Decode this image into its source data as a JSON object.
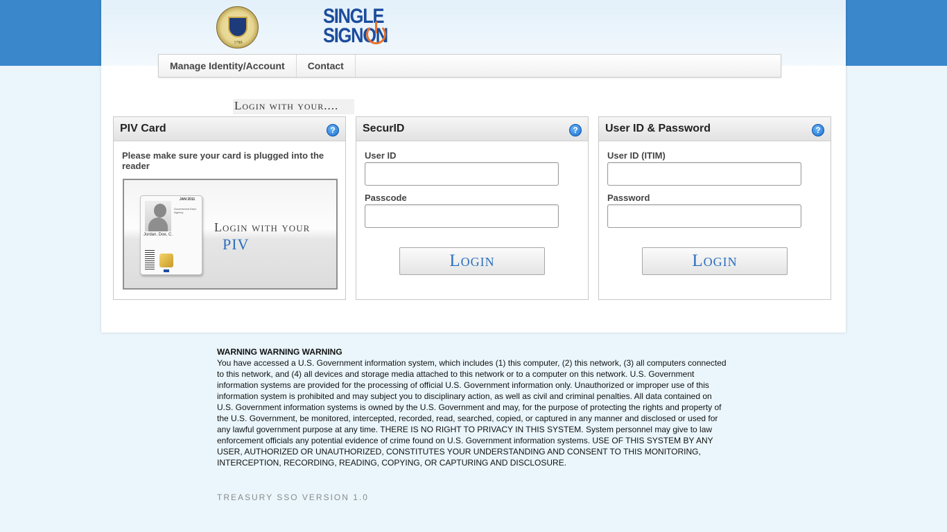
{
  "seal": {
    "text": "1789"
  },
  "logo": {
    "line1": "SINGLE",
    "line2": "SIGNON"
  },
  "nav": {
    "items": [
      "Manage Identity/Account",
      "Contact"
    ]
  },
  "login_with": "Login with your....",
  "panels": {
    "piv": {
      "title": "PIV Card",
      "message": "Please make sure your card is plugged into the reader",
      "card_date": "JAN 2011",
      "card_lines": "Government Dept. Agency",
      "card_name": "Jordan, Doe, C.",
      "image_text1": "Login with your",
      "image_text2": "PIV"
    },
    "securid": {
      "title": "SecurID",
      "user_label": "User ID",
      "user_value": "",
      "pass_label": "Passcode",
      "pass_value": "",
      "button": "Login"
    },
    "userpass": {
      "title": "User ID & Password",
      "user_label": "User ID (ITIM)",
      "user_value": "",
      "pass_label": "Password",
      "pass_value": "",
      "button": "Login"
    }
  },
  "help_symbol": "?",
  "warning": {
    "title": "WARNING WARNING WARNING",
    "body": "You have accessed a U.S. Government information system, which includes (1) this computer, (2) this network, (3) all computers connected to this network, and (4) all devices and storage media attached to this network or to a computer on this network. U.S. Government information systems are provided for the processing of official U.S. Government information only. Unauthorized or improper use of this information system is prohibited and may subject you to disciplinary action, as well as civil and criminal penalties. All data contained on U.S. Government information systems is owned by the U.S. Government and may, for the purpose of protecting the rights and property of the U.S. Government, be monitored, intercepted, recorded, read, searched, copied, or captured in any manner and disclosed or used for any lawful government purpose at any time. THERE IS NO RIGHT TO PRIVACY IN THIS SYSTEM. System personnel may give to law enforcement officials any potential evidence of crime found on U.S. Government information systems. USE OF THIS SYSTEM BY ANY USER, AUTHORIZED OR UNAUTHORIZED, CONSTITUTES YOUR UNDERSTANDING AND CONSENT TO THIS MONITORING, INTERCEPTION, RECORDING, READING, COPYING, OR CAPTURING AND DISCLOSURE."
  },
  "version": "TREASURY SSO VERSION 1.0",
  "colors": {
    "band": "#3a87cc",
    "page_bg": "#eaf6fc",
    "accent_blue": "#2a6fbf",
    "logo_orange": "#e8722a"
  }
}
